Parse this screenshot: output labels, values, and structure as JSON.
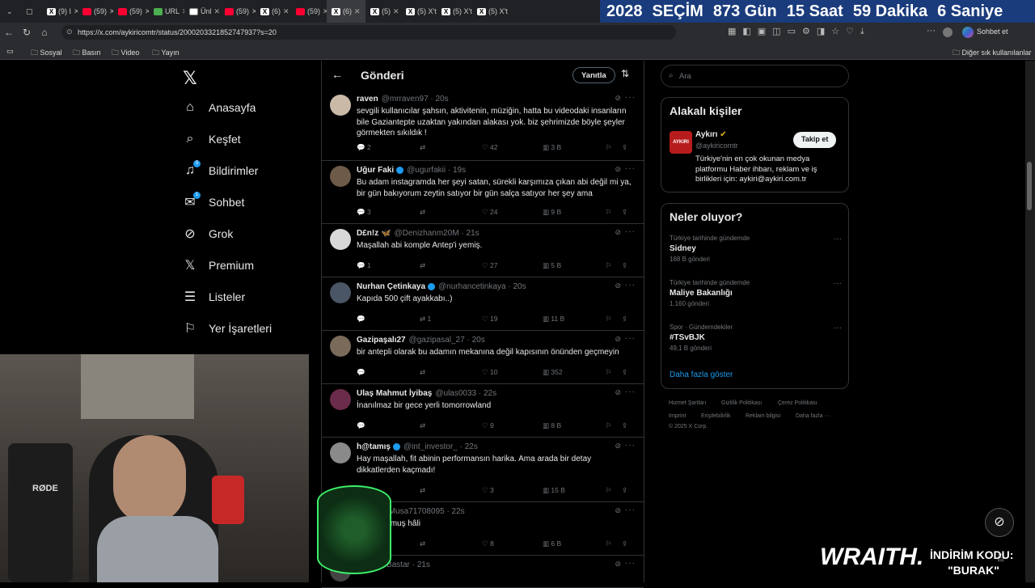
{
  "browser": {
    "tabs": [
      {
        "icon": "x",
        "label": "(9) I"
      },
      {
        "icon": "yt",
        "label": "(59)"
      },
      {
        "icon": "yt",
        "label": "(59)"
      },
      {
        "icon": "g",
        "label": "URL"
      },
      {
        "icon": "r",
        "label": "Ünl"
      },
      {
        "icon": "yt",
        "label": "(59)"
      },
      {
        "icon": "x",
        "label": "(6)"
      },
      {
        "icon": "yt",
        "label": "(59)"
      },
      {
        "icon": "x",
        "label": "(6)",
        "active": true
      },
      {
        "icon": "x",
        "label": "(5)"
      },
      {
        "icon": "x",
        "label": "(5) X'te"
      },
      {
        "icon": "x",
        "label": "(5) X'te"
      },
      {
        "icon": "x",
        "label": "(5) X'te"
      }
    ],
    "url": "https://x.com/aykiricomtr/status/2000203321852747937?s=20",
    "bookmarks": [
      "Sosyal",
      "Basın",
      "Video",
      "Yayın"
    ],
    "other_bookmarks": "Diğer sık kullanılanlar",
    "copilot": "Sohbet et"
  },
  "banner": {
    "year": "2028",
    "election": "SEÇİM",
    "days": "873 Gün",
    "hours": "15 Saat",
    "minutes": "59 Dakika",
    "seconds": "6 Saniye"
  },
  "nav": {
    "items": [
      {
        "label": "Anasayfa",
        "icon": "home-icon"
      },
      {
        "label": "Keşfet",
        "icon": "search-icon"
      },
      {
        "label": "Bildirimler",
        "icon": "bell-icon",
        "badge": "5"
      },
      {
        "label": "Sohbet",
        "icon": "mail-icon",
        "badge": "1"
      },
      {
        "label": "Grok",
        "icon": "grok-icon"
      },
      {
        "label": "Premium",
        "icon": "x-logo-icon"
      },
      {
        "label": "Listeler",
        "icon": "list-icon"
      },
      {
        "label": "Yer İşaretleri",
        "icon": "bookmark-icon"
      }
    ]
  },
  "center": {
    "title": "Gönderi",
    "reply_button": "Yanıtla"
  },
  "tweets": [
    {
      "name": "raven",
      "verified": false,
      "handle": "@mrraven97 · 20s",
      "text": "sevgili kullanıcılar şahsın, aktivitenin, müziğin, hatta bu videodaki insanların bile Gaziantepte uzaktan yakından alakası yok. biz şehrimizde böyle şeyler görmekten sıkıldık !",
      "replies": "2",
      "retweets": "",
      "likes": "42",
      "views": "3 B"
    },
    {
      "name": "Uğur Faki",
      "verified": true,
      "handle": "@ugurfakii · 19s",
      "text": "Bu adam instagramda her şeyi satan, sürekli karşımıza çıkan abi değil mi ya, bir gün bakıyorum zeytin satıyor bir gün salça satıyor her şey ama",
      "replies": "3",
      "retweets": "",
      "likes": "24",
      "views": "9 B"
    },
    {
      "name": "D£n!z 🦋",
      "verified": false,
      "handle": "@Denizhanm20M · 21s",
      "text": "Maşallah abi komple Antep'i yemiş.",
      "replies": "1",
      "retweets": "",
      "likes": "27",
      "views": "5 B"
    },
    {
      "name": "Nurhan Çetinkaya",
      "verified": true,
      "handle": "@nurhancetinkaya · 20s",
      "text": "Kapıda 500 çift ayakkabı..)",
      "replies": "",
      "retweets": "1",
      "likes": "19",
      "views": "11 B"
    },
    {
      "name": "Gazipaşalı27",
      "verified": false,
      "handle": "@gazipasal_27 · 20s",
      "text": "bir antepli olarak bu adamın mekanına değil kapısının önünden geçmeyin",
      "replies": "",
      "retweets": "",
      "likes": "10",
      "views": "352"
    },
    {
      "name": "Ulaş Mahmut İyibaş",
      "verified": false,
      "handle": "@ulas0033 · 22s",
      "text": "İnanılmaz bir gece yerli tomorrowland",
      "replies": "",
      "retweets": "",
      "likes": "9",
      "views": "8 B"
    },
    {
      "name": "h@tamış",
      "verified": true,
      "handle": "@int_investor_ · 22s",
      "text": "Hay maşallah, fit abinin performansın harika. Ama arada bir detay dikkatlerden kaçmadı!",
      "replies": "",
      "retweets": "",
      "likes": "3",
      "views": "15 B"
    },
    {
      "name": "Musa",
      "verified": false,
      "handle": "@Musa71708095 · 22s",
      "text": "Yücut bulmuş hâli",
      "replies": "",
      "retweets": "",
      "likes": "8",
      "views": "6 B"
    },
    {
      "name": "",
      "verified": false,
      "handle": "@EnesBastar · 21s",
      "text": "",
      "replies": "",
      "retweets": "",
      "likes": "",
      "views": ""
    }
  ],
  "right": {
    "search_placeholder": "Ara",
    "related_title": "Alakalı kişiler",
    "related": {
      "name": "Aykırı",
      "handle": "@aykiricomtr",
      "bio": "Türkiye'nin en çok okunan medya platformu Haber ihbarı, reklam ve iş birlikleri için: aykiri@aykiri.com.tr",
      "follow": "Takip et",
      "logo": "AYKIRI"
    },
    "trends_title": "Neler oluyor?",
    "trends": [
      {
        "context": "Türkiye tarihinde gündemde",
        "name": "Sidney",
        "count": "168 B gönderi"
      },
      {
        "context": "Türkiye tarihinde gündemde",
        "name": "Maliye Bakanlığı",
        "count": "1.160 gönderi"
      },
      {
        "context": "Spor · Gündemdekiler",
        "name": "#TSvBJK",
        "count": "49,1 B gönderi"
      }
    ],
    "show_more": "Daha fazla göster",
    "footer": [
      "Hizmet Şartları",
      "Gizlilik Politikası",
      "Çerez Politikası",
      "Imprint",
      "Erişilebilirlik",
      "Reklam bilgisi",
      "Daha fazla ···",
      "© 2025 X Corp."
    ]
  },
  "overlay": {
    "sponsor": "WRAITH.",
    "promo_line1": "İNDİRİM KODU:",
    "promo_line2": "\"BURAK\"",
    "webcam_brand": "RØDE"
  },
  "colors": {
    "accent": "#1d9bf0",
    "banner": "#1a3b7c",
    "bg": "#000000",
    "border": "#2f3336"
  }
}
